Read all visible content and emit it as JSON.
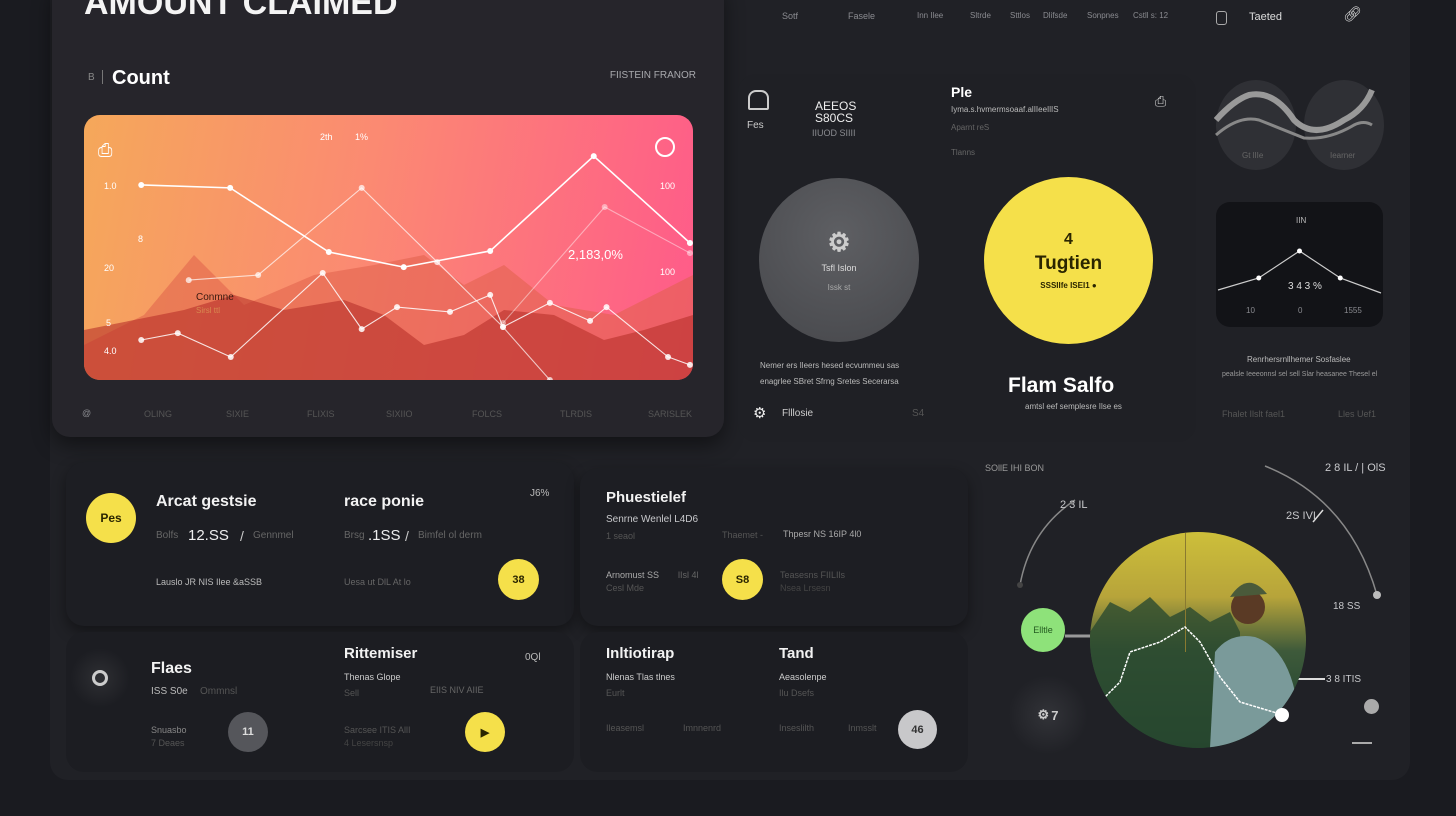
{
  "header": {
    "title": "AMOUNT CLAIMED"
  },
  "count_card": {
    "icon_label": "B",
    "title": "Count",
    "filter": "FIISTEIN FRANOR",
    "x_labels": [
      "@",
      "OLING",
      "SIXIE",
      "FLIXIS",
      "SIXIIO",
      "FOLCS",
      "TLRDIS",
      "SARISLEK"
    ]
  },
  "chart_data": {
    "type": "line",
    "title": "Count",
    "xlim": [
      0,
      100
    ],
    "ylim": [
      0,
      100
    ],
    "y_labels_left": [
      "1.0",
      "8",
      "20",
      "5",
      "4.0"
    ],
    "y_labels_right": [
      "100",
      "100"
    ],
    "top_labels": [
      "2th",
      "1%"
    ],
    "annotation": "2,183,0%",
    "legend": {
      "title": "Conmne",
      "subtitle": "Sirsl ttl"
    },
    "series": [
      {
        "name": "series-1",
        "x": [
          9.4,
          24,
          40.2,
          52.5,
          66.7,
          83.7,
          99.5
        ],
        "y": [
          73.6,
          72.5,
          48.3,
          42.6,
          48.7,
          84.5,
          51.7
        ]
      },
      {
        "name": "series-2",
        "x": [
          9.4,
          15.4,
          24.1,
          39.2,
          45.6,
          51.4,
          60.1,
          66.7,
          68.8,
          76.5,
          83.1,
          85.8,
          95.9,
          99.5
        ],
        "y": [
          15.1,
          17.7,
          8.7,
          40.4,
          19.2,
          27.5,
          25.7,
          32.1,
          20.0,
          29.1,
          22.3,
          27.5,
          8.7,
          5.7
        ]
      },
      {
        "name": "series-3",
        "x": [
          17.2,
          28.6,
          45.6,
          58,
          68.8,
          76.5
        ],
        "y": [
          37.7,
          39.6,
          72.5,
          44.5,
          20.0,
          0
        ]
      },
      {
        "name": "series-4",
        "x": [
          68.8,
          85.5,
          99.5
        ],
        "y": [
          21.5,
          65.3,
          47.9
        ]
      }
    ]
  },
  "nav": {
    "items": [
      "Sotf",
      "Fasele",
      "Inn Ilee",
      "Sltrde",
      "Sttlos",
      "Dlifsde",
      "Sonpnes",
      "Cstll s: 12"
    ],
    "active": "Taeted"
  },
  "summary": {
    "fes_label": "Fes",
    "code_1": "AEEOS",
    "code_2": "S80CS",
    "code_sub": "IIUOD SIIII",
    "ple_title": "Ple",
    "ple_line1": "Iyma.s.hvmermsoaaf.alIIeeIlIS",
    "ple_line2": "Aparnt reS",
    "ple_line3": "Tlanns",
    "gray_circle": {
      "title": "Tsfl Islon",
      "sub": "Issk st"
    },
    "yellow_circle": {
      "number": "4",
      "title": "Tugtien",
      "sub": "SSSIIfe ISEI1 ●"
    },
    "desc_1": "Nemer ers Ileers hesed ecvummeu sas",
    "desc_2": "enagrlee SBret Sfrng Sretes Secerarsa",
    "settings_label": "Flllosie",
    "settings_value": "S4",
    "big_title": "Flam Salfo",
    "big_sub": "amtsl eef semplesre Ilse es"
  },
  "side": {
    "wave_labels": [
      "Gt lIIe",
      "Iearner"
    ],
    "mini_chart": {
      "title": "IIN",
      "value": "3 4 3 %",
      "x_labels": [
        "10",
        "0",
        "1555"
      ],
      "y": [
        20,
        40,
        85,
        40,
        15
      ]
    },
    "desc_1": "Renrhersrnllhemer Sosfaslee",
    "desc_2": "pealsle Ieeeonnsl sel sell Slar heasanee Thesel el",
    "foot_left": "Fhalet Ilslt fael1",
    "foot_right": "Lles Uef1"
  },
  "cards": {
    "a": {
      "badge": "Pes",
      "title": "Arcat gestsie",
      "pre": "Bolfs",
      "value": "12.SS",
      "sep": "/",
      "unit": "Gennmel",
      "note": "Lauslo JR NIS Ilee &aSSB",
      "title2": "race ponie",
      "pre2": "Brsg",
      "value2": ".1SS",
      "unit2": "Bimfel ol derm",
      "note2": "Uesa ut DlL At lo",
      "pct": "J6%",
      "button": "38"
    },
    "b": {
      "title": "Phuestielef",
      "sub": "Senrne Wenlel L4D6",
      "sub2": "1 seaol",
      "mid": "Thaemet -",
      "right": "Thpesr NS 16IP 4l0",
      "l1": "Arnomust SS",
      "l2": "Cesl Mde",
      "l3": "lIsl 4l",
      "button": "S8",
      "r1": "Teasesns FIILIls",
      "r2": "Nsea Lrsesn"
    },
    "c": {
      "title": "Flaes",
      "value": "ISS S0e",
      "unit": "Ommnsl",
      "l1": "Snuasbo",
      "l2": "7 Deaes",
      "button": "11",
      "title2": "Rittemiser",
      "sub2": "Thenas Glope",
      "sub3": "Sell",
      "mid": "EIIS NIV AIIE",
      "l3": "Sarcsee ITIS AllI",
      "l4": "4 Lesersnsp",
      "code": "0Ql",
      "play": "▶"
    },
    "d": {
      "title": "Inltiotirap",
      "sub": "Nlenas Tlas tlnes",
      "sub2": "Eurlt",
      "l1": "Ileasemsl",
      "l2": "Imnnenrd",
      "title2": "Tand",
      "sub3": "Aeasolenpe",
      "sub4": "Ilu Dsefs",
      "l3": "Inseslilth",
      "l4": "Inmsslt",
      "button": "46"
    }
  },
  "profile": {
    "title": "SOllE IHI BON",
    "top_right": "2 8 IL / | OlS",
    "arc_left": "2 3 IL",
    "arc_right": "2S IVI",
    "green_badge": "Elltle",
    "right_val": "18 SS",
    "pointer_val": "3 8 ITIS",
    "gear_val": "7",
    "green": "#8ee27a"
  },
  "colors": {
    "accent": "#f5e04a",
    "bg": "#1a1b20",
    "panel": "#24252a"
  }
}
